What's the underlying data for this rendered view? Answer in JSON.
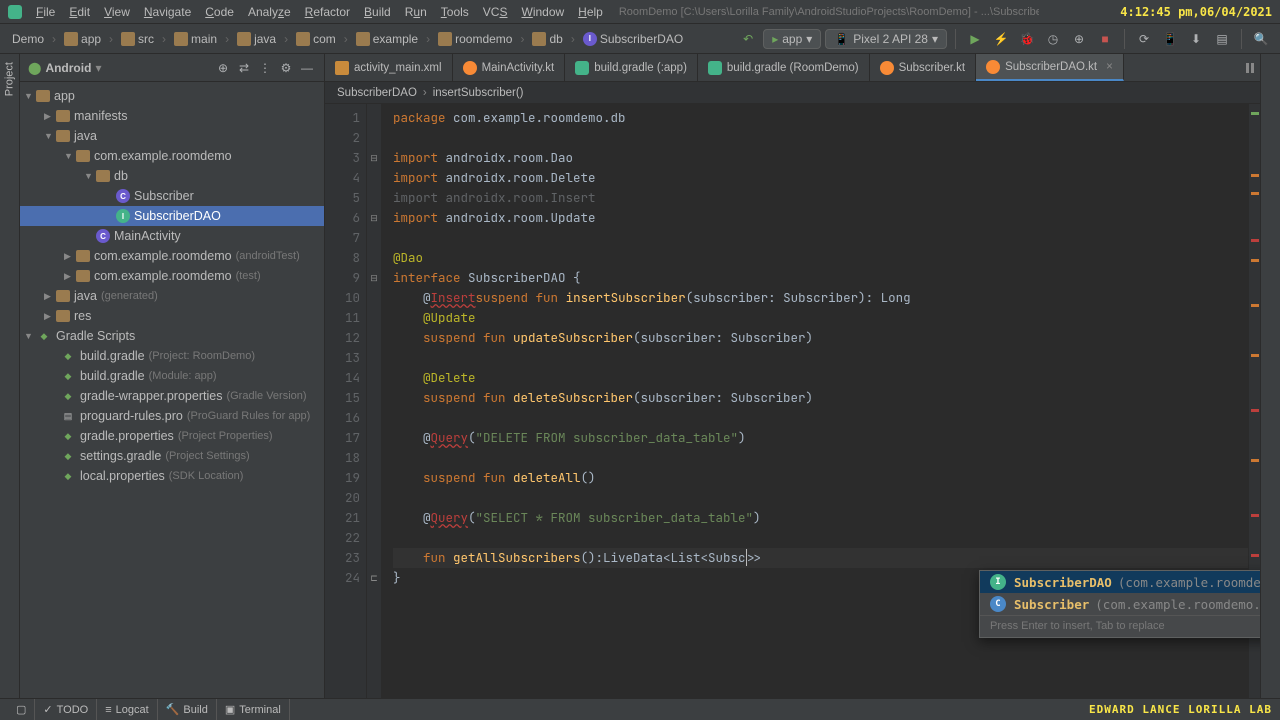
{
  "timestamp": "4:12:45 pm,06/04/2021",
  "project_path": "RoomDemo [C:\\Users\\Lorilla Family\\AndroidStudioProjects\\RoomDemo] - ...\\SubscriberDAO.kt [app]",
  "menu": [
    "File",
    "Edit",
    "View",
    "Navigate",
    "Code",
    "Analyze",
    "Refactor",
    "Build",
    "Run",
    "Tools",
    "VCS",
    "Window",
    "Help"
  ],
  "breadcrumbs": [
    "Demo",
    "app",
    "src",
    "main",
    "java",
    "com",
    "example",
    "roomdemo",
    "db",
    "SubscriberDAO"
  ],
  "run_config": "app",
  "device": "Pixel 2 API 28",
  "sidebar_title": "Android",
  "tree": {
    "app": "app",
    "manifests": "manifests",
    "java": "java",
    "pkg1": "com.example.roomdemo",
    "db": "db",
    "subscriber": "Subscriber",
    "subscriberdao": "SubscriberDAO",
    "mainactivity": "MainActivity",
    "pkg2": "com.example.roomdemo",
    "pkg2_hint": "(androidTest)",
    "pkg3": "com.example.roomdemo",
    "pkg3_hint": "(test)",
    "java_gen": "java",
    "java_gen_hint": "(generated)",
    "res": "res",
    "gradle_scripts": "Gradle Scripts",
    "bgradle1": "build.gradle",
    "bgradle1_hint": "(Project: RoomDemo)",
    "bgradle2": "build.gradle",
    "bgradle2_hint": "(Module: app)",
    "gwrap": "gradle-wrapper.properties",
    "gwrap_hint": "(Gradle Version)",
    "prules": "proguard-rules.pro",
    "prules_hint": "(ProGuard Rules for app)",
    "gprops": "gradle.properties",
    "gprops_hint": "(Project Properties)",
    "sgradle": "settings.gradle",
    "sgradle_hint": "(Project Settings)",
    "lprops": "local.properties",
    "lprops_hint": "(SDK Location)"
  },
  "tabs": [
    {
      "label": "activity_main.xml",
      "type": "xml"
    },
    {
      "label": "MainActivity.kt",
      "type": "kt"
    },
    {
      "label": "build.gradle (:app)",
      "type": "gradle"
    },
    {
      "label": "build.gradle (RoomDemo)",
      "type": "gradle"
    },
    {
      "label": "Subscriber.kt",
      "type": "kt"
    },
    {
      "label": "SubscriberDAO.kt",
      "type": "kt",
      "active": true
    }
  ],
  "code_breadcrumb": [
    "SubscriberDAO",
    "insertSubscriber()"
  ],
  "code": {
    "l1_kw": "package",
    "l1": " com.example.roomdemo.db",
    "l3_kw": "import",
    "l3": " androidx.room.",
    "l3b": "Dao",
    "l4_kw": "import",
    "l4": " androidx.room.",
    "l4b": "Delete",
    "l5_kw": "import",
    "l5": " androidx.room.",
    "l5b": "Insert",
    "l6_kw": "import",
    "l6": " androidx.room.",
    "l6b": "Update",
    "l8": "@Dao",
    "l9_kw": "interface ",
    "l9": "SubscriberDAO",
    " l9b": " {",
    "l10_a": "    @",
    "l10_b": "Insert",
    "l10_c": "suspend ",
    "l10_d": "fun ",
    "l10_e": "insertSubscriber",
    "l10_f": "(subscriber: Subscriber): Long",
    "l11": "    @Update",
    "l12_a": "    suspend ",
    "l12_b": "fun ",
    "l12_c": "updateSubscriber",
    "l12_d": "(subscriber: Subscriber)",
    "l14": "    @Delete",
    "l15_a": "    suspend ",
    "l15_b": "fun ",
    "l15_c": "deleteSubscriber",
    "l15_d": "(subscriber: Subscriber)",
    "l17_a": "    @",
    "l17_b": "Query",
    "l17_c": "(",
    "l17_d": "\"DELETE FROM subscriber_data_table\"",
    "l17_e": ")",
    "l19_a": "    suspend ",
    "l19_b": "fun ",
    "l19_c": "deleteAll",
    "l19_d": "()",
    "l21_a": "    @",
    "l21_b": "Query",
    "l21_c": "(",
    "l21_d": "\"SELECT * FROM subscriber_data_table\"",
    "l21_e": ")",
    "l23_a": "    fun ",
    "l23_b": "getAllSubscribers",
    "l23_c": "():LiveData<List<Subsc",
    "l23_d": ">>",
    "l24": "}"
  },
  "autocomplete": {
    "items": [
      {
        "name": "SubscriberDAO",
        "pkg": "(com.example.roomdemo.db)"
      },
      {
        "name": "Subscriber",
        "pkg": "(com.example.roomdemo.db)"
      }
    ],
    "hint": "Press Enter to insert, Tab to replace"
  },
  "statusbar": {
    "todo": "TODO",
    "logcat": "Logcat",
    "build": "Build",
    "terminal": "Terminal"
  },
  "watermark": "EDWARD LANCE LORILLA LAB"
}
